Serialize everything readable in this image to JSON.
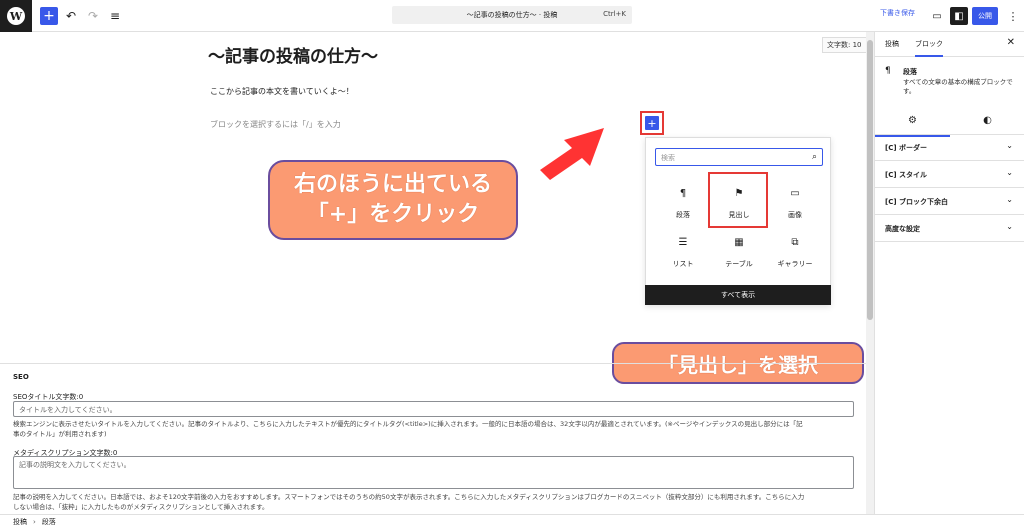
{
  "toolbar": {
    "doc_title": "〜記事の投稿の仕方〜 · 投稿",
    "shortcut": "Ctrl+K",
    "save_draft": "下書き保存",
    "publish": "公開"
  },
  "editor": {
    "word_count": "文字数: 10",
    "title": "〜記事の投稿の仕方〜",
    "paragraph": "ここから記事の本文を書いていくよ〜！",
    "placeholder": "ブロックを選択するには「/」を入力"
  },
  "inserter": {
    "search_placeholder": "検索",
    "items": [
      {
        "label": "段落",
        "icon": "¶"
      },
      {
        "label": "見出し",
        "icon": "⚑"
      },
      {
        "label": "画像",
        "icon": "▭"
      },
      {
        "label": "リスト",
        "icon": "☰"
      },
      {
        "label": "テーブル",
        "icon": "▦"
      },
      {
        "label": "ギャラリー",
        "icon": "⧉"
      }
    ],
    "browse_all": "すべて表示"
  },
  "callouts": {
    "line1": "右のほうに出ている",
    "line2": "「+」をクリック",
    "select": "「見出し」を選択"
  },
  "seo": {
    "heading": "SEO",
    "title_label": "SEOタイトル文字数:0",
    "title_placeholder": "タイトルを入力してください。",
    "title_help1": "検索エンジンに表示させたいタイトルを入力してください。記事のタイトルより、こちらに入力したテキストが優先的にタイトルタグ(<title>)に挿入されます。一般的に日本語の場合は、32文字以内が最適とされています。(※ページやインデックスの見出し部分には「記",
    "title_help2": "事のタイトル」が利用されます)",
    "desc_label": "メタディスクリプション文字数:0",
    "desc_placeholder": "記事の説明文を入力してください。",
    "desc_help1": "記事の説明を入力してください。日本語では、およそ120文字前後の入力をおすすめします。スマートフォンではそのうちの約50文字が表示されます。こちらに入力したメタディスクリプションはブログカードのスニペット（抜粋文部分）にも利用されます。こちらに入力",
    "desc_help2": "しない場合は、「抜粋」に入力したものがメタディスクリプションとして挿入されます。"
  },
  "breadcrumb": {
    "root": "投稿",
    "current": "段落"
  },
  "sidebar": {
    "tab_post": "投稿",
    "tab_block": "ブロック",
    "block_name": "段落",
    "block_desc": "すべての文章の基本の構成ブロックです。",
    "panels": [
      "[C] ボーダー",
      "[C] スタイル",
      "[C] ブロック下余白",
      "高度な設定"
    ]
  },
  "colors": {
    "accent": "#3858e9",
    "callout": "#fb9a72",
    "highlight": "#e53935"
  }
}
